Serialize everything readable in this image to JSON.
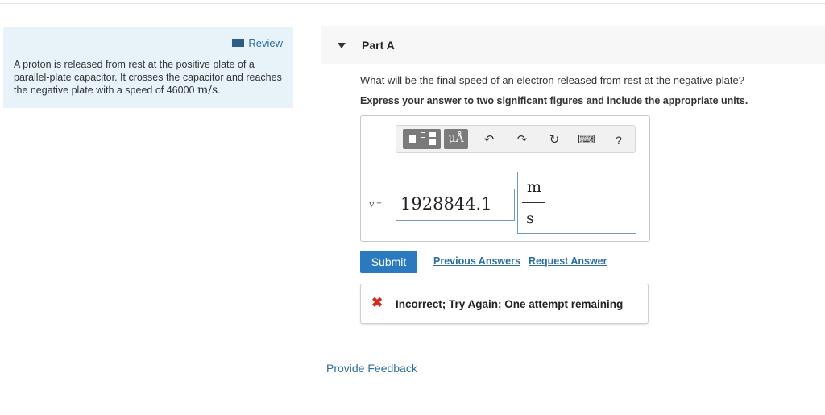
{
  "review": {
    "link_label": "Review",
    "problem_text": "A proton is released from rest at the positive plate of a parallel-plate capacitor. It crosses the capacitor and reaches the negative plate with a speed of 46000",
    "problem_unit": "m/s",
    "problem_end": "."
  },
  "part": {
    "title": "Part A",
    "question": "What will be the final speed of an electron released from rest at the negative plate?",
    "instruction": "Express your answer to two significant figures and include the appropriate units."
  },
  "toolbar": {
    "units_label": "μÅ",
    "undo_glyph": "↶",
    "redo_glyph": "↷",
    "reset_glyph": "↻",
    "keyboard_glyph": "⌨",
    "help_label": "?",
    "icons": [
      "templates-icon",
      "units-icon",
      "undo-icon",
      "redo-icon",
      "reset-icon",
      "keyboard-icon",
      "help-icon"
    ]
  },
  "answer": {
    "variable": "v",
    "equals": "=",
    "value": "1928844.1",
    "unit_numerator": "m",
    "unit_denominator": "s"
  },
  "actions": {
    "submit_label": "Submit",
    "previous_answers_label": "Previous Answers",
    "request_answer_label": "Request Answer"
  },
  "feedback": {
    "icon_glyph": "✖",
    "message": "Incorrect; Try Again; One attempt remaining"
  },
  "footer": {
    "provide_feedback_label": "Provide Feedback"
  },
  "colors": {
    "accent": "#2b7abf",
    "link": "#2b6e9e",
    "review_bg": "#e8f3f9",
    "error": "#d9261c"
  }
}
